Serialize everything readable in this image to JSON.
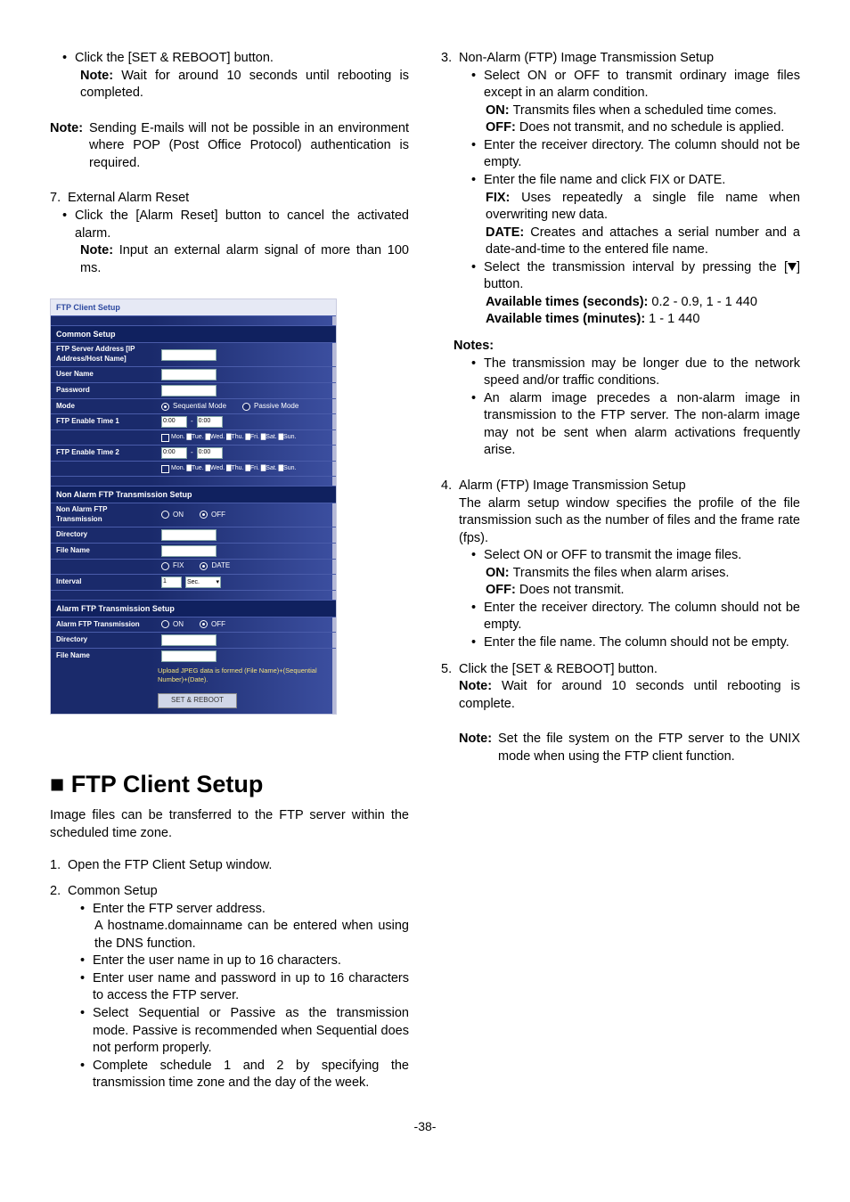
{
  "left": {
    "b1": "Click the [SET & REBOOT] button.",
    "b1_note": "Wait for around 10 seconds until rebooting is completed.",
    "note1": "Sending E-mails will not be possible in an environment where POP (Post Office Protocol) authentication is required.",
    "s7_num": "7.",
    "s7_title": "External Alarm Reset",
    "s7_b1": "Click the [Alarm Reset] button to cancel the activated alarm.",
    "s7_note": "Input an external alarm signal of more than 100 ms.",
    "h1": "■ FTP Client Setup",
    "intro": "Image files can be transferred to the FTP server within the scheduled time zone.",
    "s1_num": "1.",
    "s1": "Open the FTP Client Setup window.",
    "s2_num": "2.",
    "s2": "Common Setup",
    "s2_b1": "Enter the FTP server address.",
    "s2_b1a": "A hostname.domainname can be entered when using the DNS function.",
    "s2_b2": "Enter the user name in up to 16 characters.",
    "s2_b3": "Enter user name and password in up to 16 characters to access the FTP server.",
    "s2_b4": "Select Sequential or Passive as the transmission mode. Passive is recommended when Sequential does not perform properly.",
    "s2_b5": "Complete schedule 1 and 2 by specifying the transmission time zone and the day of the week."
  },
  "right": {
    "s3_num": "3.",
    "s3": "Non-Alarm (FTP) Image Transmission Setup",
    "s3_b1": "Select ON or OFF to transmit ordinary image files except in an alarm condition.",
    "s3_b1_on": "Transmits files when a scheduled time comes.",
    "s3_b1_off": "Does not transmit, and no schedule is applied.",
    "s3_b2": "Enter the receiver directory. The column should not be empty.",
    "s3_b3": "Enter the file name and click FIX or DATE.",
    "s3_b3_fix": "Uses repeatedly a single file name when overwriting new data.",
    "s3_b3_date": "Creates and attaches a serial number and a date-and-time to the entered file name.",
    "s3_b4a": "Select the transmission interval by pressing the [",
    "s3_b4b": "] button.",
    "s3_b4_av1_lbl": "Available times (seconds):",
    "s3_b4_av1_val": " 0.2 - 0.9, 1 - 1 440",
    "s3_b4_av2_lbl": "Available times (minutes):",
    "s3_b4_av2_val": " 1 - 1 440",
    "notes_hdr": "Notes:",
    "notes_b1": "The transmission may be longer due to the network speed and/or traffic conditions.",
    "notes_b2": "An alarm image precedes a non-alarm image in transmission to the FTP server. The non-alarm image may not be sent when alarm activations frequently arise.",
    "s4_num": "4.",
    "s4": "Alarm (FTP) Image Transmission Setup",
    "s4_intro": "The alarm setup window specifies the profile of the file transmission such as the number of files and the frame rate (fps).",
    "s4_b1": "Select ON or OFF to transmit the image files.",
    "s4_b1_on": "Transmits the files when alarm arises.",
    "s4_b1_off": "Does not transmit.",
    "s4_b2": "Enter the receiver directory. The column should not be empty.",
    "s4_b3": "Enter the file name. The column should not be empty.",
    "s5_num": "5.",
    "s5": "Click the [SET & REBOOT] button.",
    "s5_note": "Wait for around 10 seconds until rebooting is complete.",
    "final_note": "Set the file system on the FTP server to the UNIX mode when using the FTP client function."
  },
  "panel": {
    "title": "FTP Client Setup",
    "sec_common": "Common Setup",
    "addr": "FTP Server Address [IP Address/Host Name]",
    "user": "User Name",
    "pass": "Password",
    "mode": "Mode",
    "mode_seq": "Sequential Mode",
    "mode_pas": "Passive Mode",
    "en1": "FTP Enable Time 1",
    "en2": "FTP Enable Time 2",
    "days": "Mon. ▇Tue. ▇Wed. ▇Thu. ▇Fri. ▇Sat. ▇Sun.",
    "t0": "0:00",
    "sec_na": "Non Alarm FTP Transmission Setup",
    "na_trans": "Non Alarm FTP Transmission",
    "dir": "Directory",
    "fname": "File Name",
    "fix": "FIX",
    "date": "DATE",
    "interval": "Interval",
    "interval_v": "1",
    "interval_u": "Sec.",
    "on": "ON",
    "off": "OFF",
    "sec_al": "Alarm FTP Transmission Setup",
    "al_trans": "Alarm FTP Transmission",
    "upload_note": "Upload JPEG data is formed (File Name)+(Sequential Number)+(Date).",
    "btn": "SET & REBOOT"
  },
  "pagefoot": "-38-"
}
